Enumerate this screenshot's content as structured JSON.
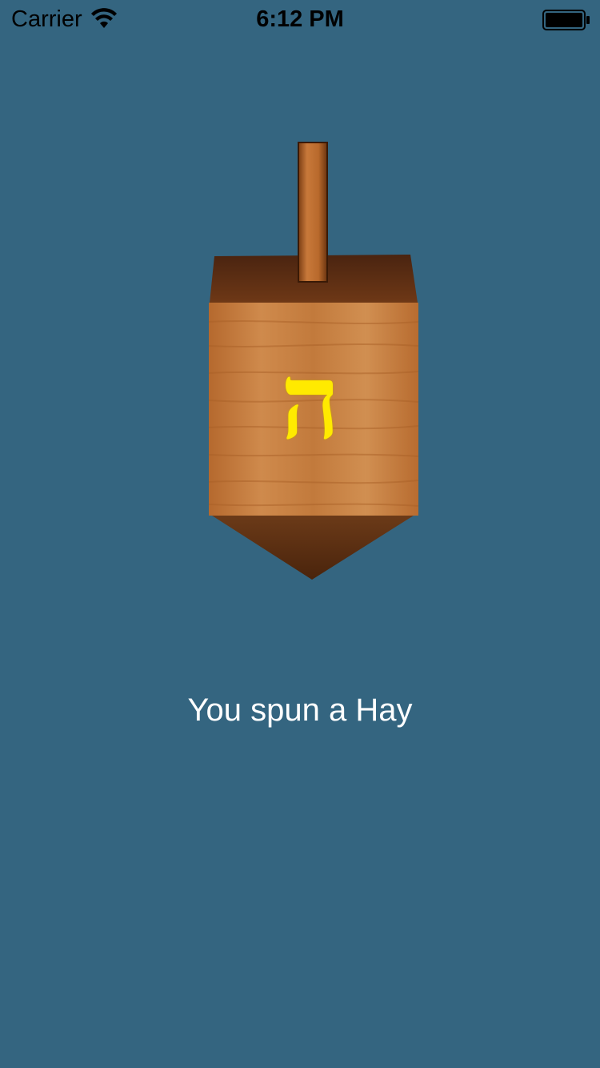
{
  "status_bar": {
    "carrier": "Carrier",
    "time": "6:12 PM",
    "wifi_icon": "wifi-icon",
    "battery_icon": "battery-full-icon"
  },
  "dreidel": {
    "face_letter": "ה",
    "letter_color": "#ffea00",
    "wood_color": "#c27a3c",
    "image": "wooden-dreidel"
  },
  "result": {
    "text": "You spun a Hay"
  },
  "colors": {
    "background": "#346580",
    "text": "#ffffff"
  }
}
